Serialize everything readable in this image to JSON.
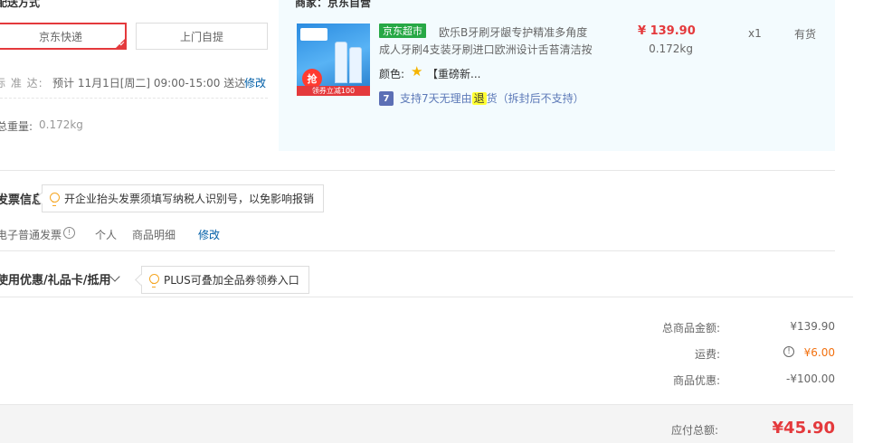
{
  "delivery": {
    "title": "配送方式",
    "options": [
      {
        "label": "京东快递",
        "selected": true
      },
      {
        "label": "上门自提",
        "selected": false
      }
    ],
    "standard_label": "标 准 达:",
    "standard_text": "预计 11月1日[周二] 09:00-15:00 送达",
    "modify": "修改",
    "weight_label": "总重量:",
    "weight_value": "0.172kg"
  },
  "product": {
    "merchant": "商家：京东自营",
    "badge": "京东超市",
    "name_line1": "欧乐B牙刷牙龈专护精准多角度",
    "name_line2": "成人牙刷4支装牙刷进口欧洲设计舌苔清洁按",
    "color_label": "颜色:",
    "color_value": "【重磅新...",
    "return_icon": "7",
    "return_before": "支持7天无理由",
    "return_highlight": "退",
    "return_after": "货（拆封后不支持）",
    "price": "¥ 139.90",
    "weight": "0.172kg",
    "qty": "x1",
    "stock": "有货",
    "image": {
      "circle_text": "抢",
      "band_text": "领券立减100"
    }
  },
  "invoice": {
    "title": "发票信息",
    "tip": "开企业抬头发票须填写纳税人识别号，以免影响报销",
    "type": "电子普通发票",
    "info_icon": "!",
    "person": "个人",
    "detail": "商品明细",
    "modify": "修改"
  },
  "coupons": {
    "title": "使用优惠/礼品卡/抵用",
    "tip": "PLUS可叠加全品券领券入口"
  },
  "summary": {
    "total_goods_label": "总商品金额:",
    "total_goods_value": "¥139.90",
    "fee_label": "运费:",
    "fee_info": "!",
    "fee_value": "¥6.00",
    "discount_label": "商品优惠:",
    "discount_value": "-¥100.00",
    "payable_label": "应付总额:",
    "payable_value": "¥45.90"
  },
  "colors": {
    "accent_red": "#e4393c",
    "jd_green": "#27a845",
    "link_blue": "#005ea7",
    "panel_bg": "#f3fbfe",
    "fee_orange": "#f2700f"
  }
}
